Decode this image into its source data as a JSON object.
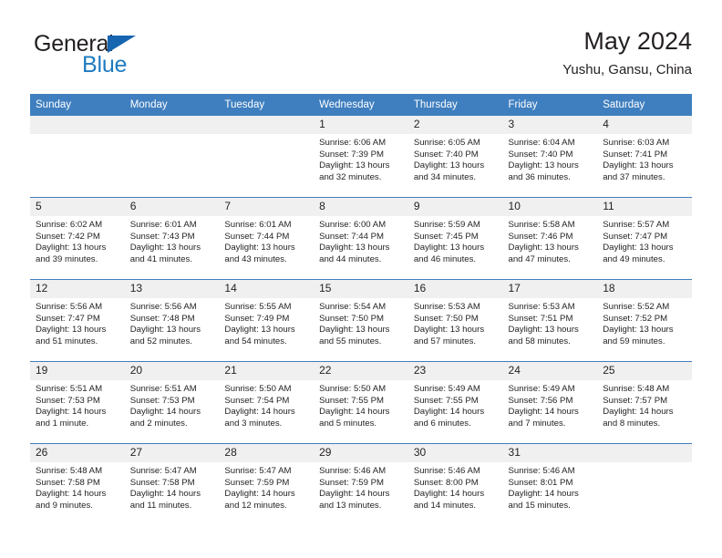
{
  "brand": {
    "name_top": "General",
    "name_bottom": "Blue",
    "accent_color": "#1f7bc1",
    "triangle_color": "#1565b0"
  },
  "header": {
    "title": "May 2024",
    "subtitle": "Yushu, Gansu, China"
  },
  "theme": {
    "header_bg": "#3f7fbf",
    "daynum_bg": "#f0f0f0",
    "text": "#231f20"
  },
  "weekday_headers": [
    "Sunday",
    "Monday",
    "Tuesday",
    "Wednesday",
    "Thursday",
    "Friday",
    "Saturday"
  ],
  "weeks": [
    [
      {
        "day": "",
        "empty": true,
        "sunrise": "",
        "sunset": "",
        "daylight_line1": "",
        "daylight_line2": ""
      },
      {
        "day": "",
        "empty": true,
        "sunrise": "",
        "sunset": "",
        "daylight_line1": "",
        "daylight_line2": ""
      },
      {
        "day": "",
        "empty": true,
        "sunrise": "",
        "sunset": "",
        "daylight_line1": "",
        "daylight_line2": ""
      },
      {
        "day": "1",
        "sunrise": "Sunrise: 6:06 AM",
        "sunset": "Sunset: 7:39 PM",
        "daylight_line1": "Daylight: 13 hours",
        "daylight_line2": "and 32 minutes."
      },
      {
        "day": "2",
        "sunrise": "Sunrise: 6:05 AM",
        "sunset": "Sunset: 7:40 PM",
        "daylight_line1": "Daylight: 13 hours",
        "daylight_line2": "and 34 minutes."
      },
      {
        "day": "3",
        "sunrise": "Sunrise: 6:04 AM",
        "sunset": "Sunset: 7:40 PM",
        "daylight_line1": "Daylight: 13 hours",
        "daylight_line2": "and 36 minutes."
      },
      {
        "day": "4",
        "sunrise": "Sunrise: 6:03 AM",
        "sunset": "Sunset: 7:41 PM",
        "daylight_line1": "Daylight: 13 hours",
        "daylight_line2": "and 37 minutes."
      }
    ],
    [
      {
        "day": "5",
        "sunrise": "Sunrise: 6:02 AM",
        "sunset": "Sunset: 7:42 PM",
        "daylight_line1": "Daylight: 13 hours",
        "daylight_line2": "and 39 minutes."
      },
      {
        "day": "6",
        "sunrise": "Sunrise: 6:01 AM",
        "sunset": "Sunset: 7:43 PM",
        "daylight_line1": "Daylight: 13 hours",
        "daylight_line2": "and 41 minutes."
      },
      {
        "day": "7",
        "sunrise": "Sunrise: 6:01 AM",
        "sunset": "Sunset: 7:44 PM",
        "daylight_line1": "Daylight: 13 hours",
        "daylight_line2": "and 43 minutes."
      },
      {
        "day": "8",
        "sunrise": "Sunrise: 6:00 AM",
        "sunset": "Sunset: 7:44 PM",
        "daylight_line1": "Daylight: 13 hours",
        "daylight_line2": "and 44 minutes."
      },
      {
        "day": "9",
        "sunrise": "Sunrise: 5:59 AM",
        "sunset": "Sunset: 7:45 PM",
        "daylight_line1": "Daylight: 13 hours",
        "daylight_line2": "and 46 minutes."
      },
      {
        "day": "10",
        "sunrise": "Sunrise: 5:58 AM",
        "sunset": "Sunset: 7:46 PM",
        "daylight_line1": "Daylight: 13 hours",
        "daylight_line2": "and 47 minutes."
      },
      {
        "day": "11",
        "sunrise": "Sunrise: 5:57 AM",
        "sunset": "Sunset: 7:47 PM",
        "daylight_line1": "Daylight: 13 hours",
        "daylight_line2": "and 49 minutes."
      }
    ],
    [
      {
        "day": "12",
        "sunrise": "Sunrise: 5:56 AM",
        "sunset": "Sunset: 7:47 PM",
        "daylight_line1": "Daylight: 13 hours",
        "daylight_line2": "and 51 minutes."
      },
      {
        "day": "13",
        "sunrise": "Sunrise: 5:56 AM",
        "sunset": "Sunset: 7:48 PM",
        "daylight_line1": "Daylight: 13 hours",
        "daylight_line2": "and 52 minutes."
      },
      {
        "day": "14",
        "sunrise": "Sunrise: 5:55 AM",
        "sunset": "Sunset: 7:49 PM",
        "daylight_line1": "Daylight: 13 hours",
        "daylight_line2": "and 54 minutes."
      },
      {
        "day": "15",
        "sunrise": "Sunrise: 5:54 AM",
        "sunset": "Sunset: 7:50 PM",
        "daylight_line1": "Daylight: 13 hours",
        "daylight_line2": "and 55 minutes."
      },
      {
        "day": "16",
        "sunrise": "Sunrise: 5:53 AM",
        "sunset": "Sunset: 7:50 PM",
        "daylight_line1": "Daylight: 13 hours",
        "daylight_line2": "and 57 minutes."
      },
      {
        "day": "17",
        "sunrise": "Sunrise: 5:53 AM",
        "sunset": "Sunset: 7:51 PM",
        "daylight_line1": "Daylight: 13 hours",
        "daylight_line2": "and 58 minutes."
      },
      {
        "day": "18",
        "sunrise": "Sunrise: 5:52 AM",
        "sunset": "Sunset: 7:52 PM",
        "daylight_line1": "Daylight: 13 hours",
        "daylight_line2": "and 59 minutes."
      }
    ],
    [
      {
        "day": "19",
        "sunrise": "Sunrise: 5:51 AM",
        "sunset": "Sunset: 7:53 PM",
        "daylight_line1": "Daylight: 14 hours",
        "daylight_line2": "and 1 minute."
      },
      {
        "day": "20",
        "sunrise": "Sunrise: 5:51 AM",
        "sunset": "Sunset: 7:53 PM",
        "daylight_line1": "Daylight: 14 hours",
        "daylight_line2": "and 2 minutes."
      },
      {
        "day": "21",
        "sunrise": "Sunrise: 5:50 AM",
        "sunset": "Sunset: 7:54 PM",
        "daylight_line1": "Daylight: 14 hours",
        "daylight_line2": "and 3 minutes."
      },
      {
        "day": "22",
        "sunrise": "Sunrise: 5:50 AM",
        "sunset": "Sunset: 7:55 PM",
        "daylight_line1": "Daylight: 14 hours",
        "daylight_line2": "and 5 minutes."
      },
      {
        "day": "23",
        "sunrise": "Sunrise: 5:49 AM",
        "sunset": "Sunset: 7:55 PM",
        "daylight_line1": "Daylight: 14 hours",
        "daylight_line2": "and 6 minutes."
      },
      {
        "day": "24",
        "sunrise": "Sunrise: 5:49 AM",
        "sunset": "Sunset: 7:56 PM",
        "daylight_line1": "Daylight: 14 hours",
        "daylight_line2": "and 7 minutes."
      },
      {
        "day": "25",
        "sunrise": "Sunrise: 5:48 AM",
        "sunset": "Sunset: 7:57 PM",
        "daylight_line1": "Daylight: 14 hours",
        "daylight_line2": "and 8 minutes."
      }
    ],
    [
      {
        "day": "26",
        "sunrise": "Sunrise: 5:48 AM",
        "sunset": "Sunset: 7:58 PM",
        "daylight_line1": "Daylight: 14 hours",
        "daylight_line2": "and 9 minutes."
      },
      {
        "day": "27",
        "sunrise": "Sunrise: 5:47 AM",
        "sunset": "Sunset: 7:58 PM",
        "daylight_line1": "Daylight: 14 hours",
        "daylight_line2": "and 11 minutes."
      },
      {
        "day": "28",
        "sunrise": "Sunrise: 5:47 AM",
        "sunset": "Sunset: 7:59 PM",
        "daylight_line1": "Daylight: 14 hours",
        "daylight_line2": "and 12 minutes."
      },
      {
        "day": "29",
        "sunrise": "Sunrise: 5:46 AM",
        "sunset": "Sunset: 7:59 PM",
        "daylight_line1": "Daylight: 14 hours",
        "daylight_line2": "and 13 minutes."
      },
      {
        "day": "30",
        "sunrise": "Sunrise: 5:46 AM",
        "sunset": "Sunset: 8:00 PM",
        "daylight_line1": "Daylight: 14 hours",
        "daylight_line2": "and 14 minutes."
      },
      {
        "day": "31",
        "sunrise": "Sunrise: 5:46 AM",
        "sunset": "Sunset: 8:01 PM",
        "daylight_line1": "Daylight: 14 hours",
        "daylight_line2": "and 15 minutes."
      },
      {
        "day": "",
        "empty": true,
        "sunrise": "",
        "sunset": "",
        "daylight_line1": "",
        "daylight_line2": ""
      }
    ]
  ]
}
